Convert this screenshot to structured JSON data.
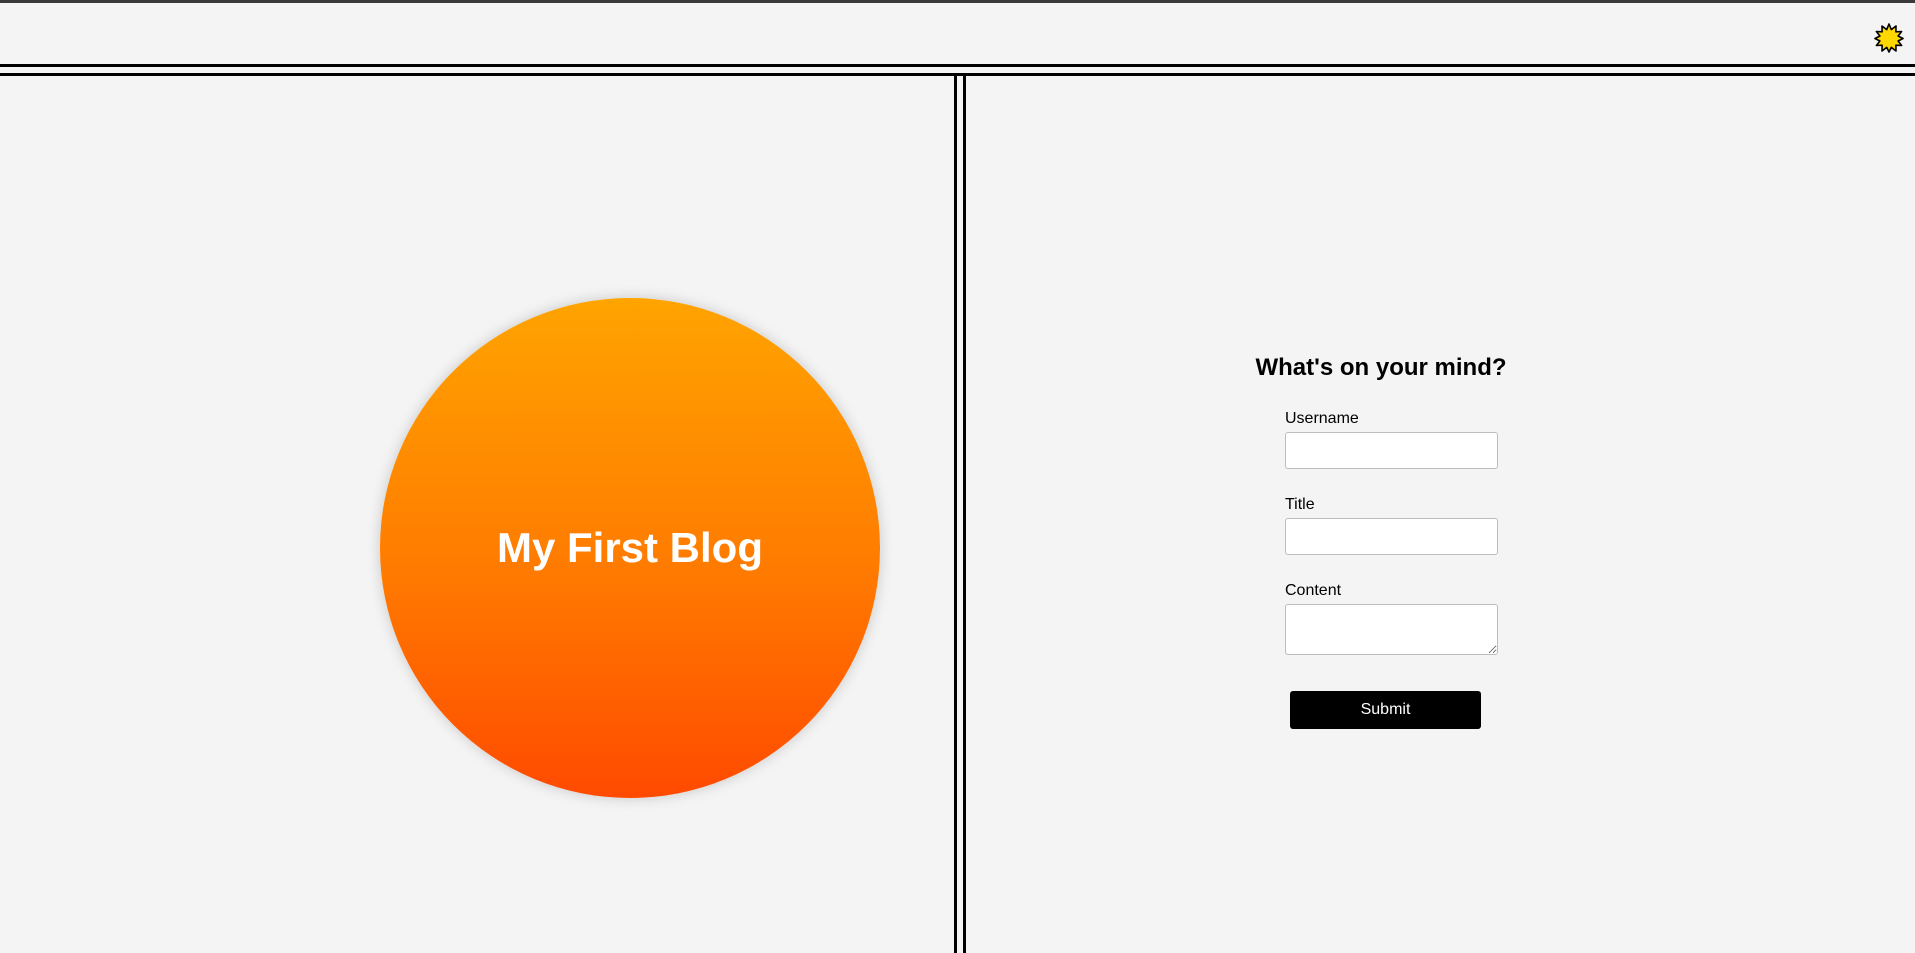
{
  "header": {
    "theme_toggle_icon": "sun-icon",
    "icon_color": "#ffd700"
  },
  "hero": {
    "title": "My First Blog",
    "gradient_top": "#ffa400",
    "gradient_bottom": "#ff4a00"
  },
  "form": {
    "heading": "What's on your mind?",
    "fields": [
      {
        "label": "Username",
        "value": ""
      },
      {
        "label": "Title",
        "value": ""
      },
      {
        "label": "Content",
        "value": ""
      }
    ],
    "submit_label": "Submit"
  },
  "colors": {
    "background": "#f4f4f4",
    "rules": "#000000",
    "button": "#000000"
  }
}
